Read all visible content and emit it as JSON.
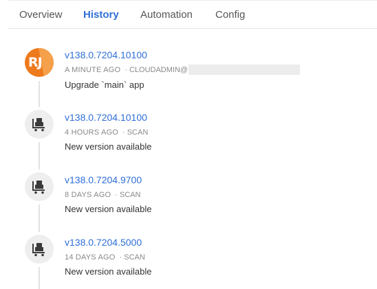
{
  "tabs": [
    {
      "label": "Overview"
    },
    {
      "label": "History"
    },
    {
      "label": "Automation"
    },
    {
      "label": "Config"
    }
  ],
  "history": [
    {
      "version": "v138.0.7204.10100",
      "time": "A MINUTE AGO",
      "source": "· CLOUDADMIN@",
      "description": "Upgrade `main` app",
      "avatar": "RJ",
      "avatar_color": "#ed7a1c"
    },
    {
      "version": "v138.0.7204.10100",
      "time": "4 HOURS AGO",
      "source": "· SCAN",
      "description": "New version available",
      "avatar_icon": "scan-cart-icon"
    },
    {
      "version": "v138.0.7204.9700",
      "time": "8 DAYS AGO",
      "source": "· SCAN",
      "description": "New version available",
      "avatar_icon": "scan-cart-icon"
    },
    {
      "version": "v138.0.7204.5000",
      "time": "14 DAYS AGO",
      "source": "· SCAN",
      "description": "New version available",
      "avatar_icon": "scan-cart-icon"
    }
  ],
  "colors": {
    "accent": "#2f6fd6",
    "avatar_bg": "#eeeeee"
  }
}
